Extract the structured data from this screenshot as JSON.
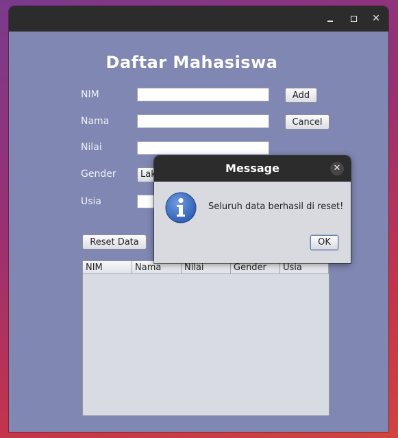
{
  "window": {
    "controls": {
      "minimize_icon": "minimize-icon",
      "maximize_icon": "maximize-icon",
      "close_icon": "close-icon"
    }
  },
  "form": {
    "title": "Daftar Mahasiswa",
    "labels": {
      "nim": "NIM",
      "nama": "Nama",
      "nilai": "Nilai",
      "gender": "Gender",
      "usia": "Usia"
    },
    "values": {
      "nim": "",
      "nama": "",
      "nilai": "",
      "usia": ""
    },
    "gender_selected": "Laki-laki",
    "buttons": {
      "add": "Add",
      "cancel": "Cancel",
      "reset": "Reset Data"
    }
  },
  "table": {
    "columns": [
      "NIM",
      "Nama",
      "Nilai",
      "Gender",
      "Usia"
    ],
    "rows": []
  },
  "dialog": {
    "title": "Message",
    "message": "Seluruh data berhasil di reset!",
    "ok_label": "OK",
    "close_glyph": "✕",
    "icon": "info-icon",
    "colors": {
      "icon_blue": "#3a6fc4",
      "titlebar": "#2c2c2c",
      "window_bg": "#7f87b2"
    }
  }
}
